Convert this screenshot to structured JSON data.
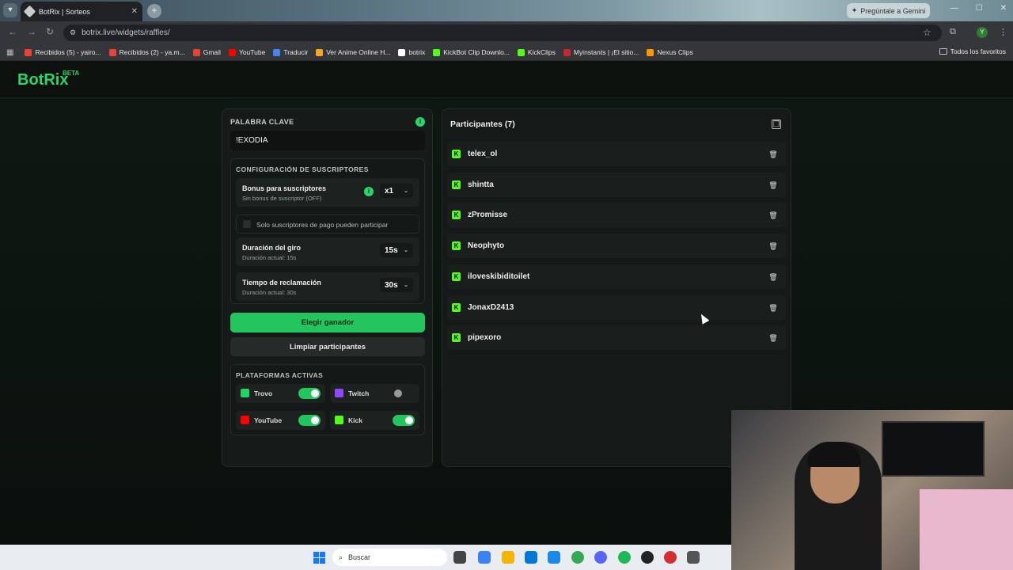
{
  "browser": {
    "tab_title": "BotRix | Sorteos",
    "tab_close": "✕",
    "new_tab": "+",
    "gemini_label": "Pregúntale a Gemini",
    "url": "botrix.live/widgets/raffles/",
    "bookmarks": [
      {
        "label": "Recibidos (5) - yairo...",
        "color": "#ea4335"
      },
      {
        "label": "Recibidos (2) - ya.m...",
        "color": "#ea4335"
      },
      {
        "label": "Gmail",
        "color": "#ea4335"
      },
      {
        "label": "YouTube",
        "color": "#ff0000"
      },
      {
        "label": "Traducir",
        "color": "#4285f4"
      },
      {
        "label": "Ver Anime Online H...",
        "color": "#f5a623"
      },
      {
        "label": "botrix",
        "color": "#ffffff"
      },
      {
        "label": "KickBot Clip Downlo...",
        "color": "#53fc18"
      },
      {
        "label": "KickClips",
        "color": "#53fc18"
      },
      {
        "label": "Myinstants | ¡El sitio...",
        "color": "#c62828"
      },
      {
        "label": "Nexus Clips",
        "color": "#ff9800"
      }
    ],
    "all_bookmarks": "Todos los favoritos",
    "avatar_letter": "Y"
  },
  "app": {
    "logo": "BotRix",
    "beta": "BETA"
  },
  "keyword": {
    "label": "PALABRA CLAVE",
    "value": "!EXODIA"
  },
  "subs": {
    "title": "CONFIGURACIÓN DE SUSCRIPTORES",
    "bonus_title": "Bonus para suscriptores",
    "bonus_sub": "Sin bonus de suscriptor (OFF)",
    "bonus_value": "x1",
    "only_paid": "Solo suscriptores de pago pueden participar",
    "spin_title": "Duración del giro",
    "spin_sub": "Duración actual: 15s",
    "spin_value": "15s",
    "claim_title": "Tiempo de reclamación",
    "claim_sub": "Duración actual: 30s",
    "claim_value": "30s"
  },
  "actions": {
    "choose_winner": "Elegir ganador",
    "clear": "Limpiar participantes"
  },
  "platforms": {
    "title": "PLATAFORMAS ACTIVAS",
    "items": [
      {
        "name": "Trovo",
        "enabled": true,
        "color": "#1ed761"
      },
      {
        "name": "Twitch",
        "enabled": false,
        "color": "#9146ff"
      },
      {
        "name": "YouTube",
        "enabled": true,
        "color": "#ff0000"
      },
      {
        "name": "Kick",
        "enabled": true,
        "color": "#53fc18"
      }
    ]
  },
  "participants": {
    "title": "Participantes (7)",
    "list": [
      "telex_ol",
      "shintta",
      "zPromisse",
      "Neophyto",
      "iloveskibiditoilet",
      "JonaxD2413",
      "pipexoro"
    ]
  },
  "taskbar": {
    "search_placeholder": "Buscar"
  },
  "colors": {
    "accent": "#22c55e",
    "kick": "#53fc18"
  }
}
